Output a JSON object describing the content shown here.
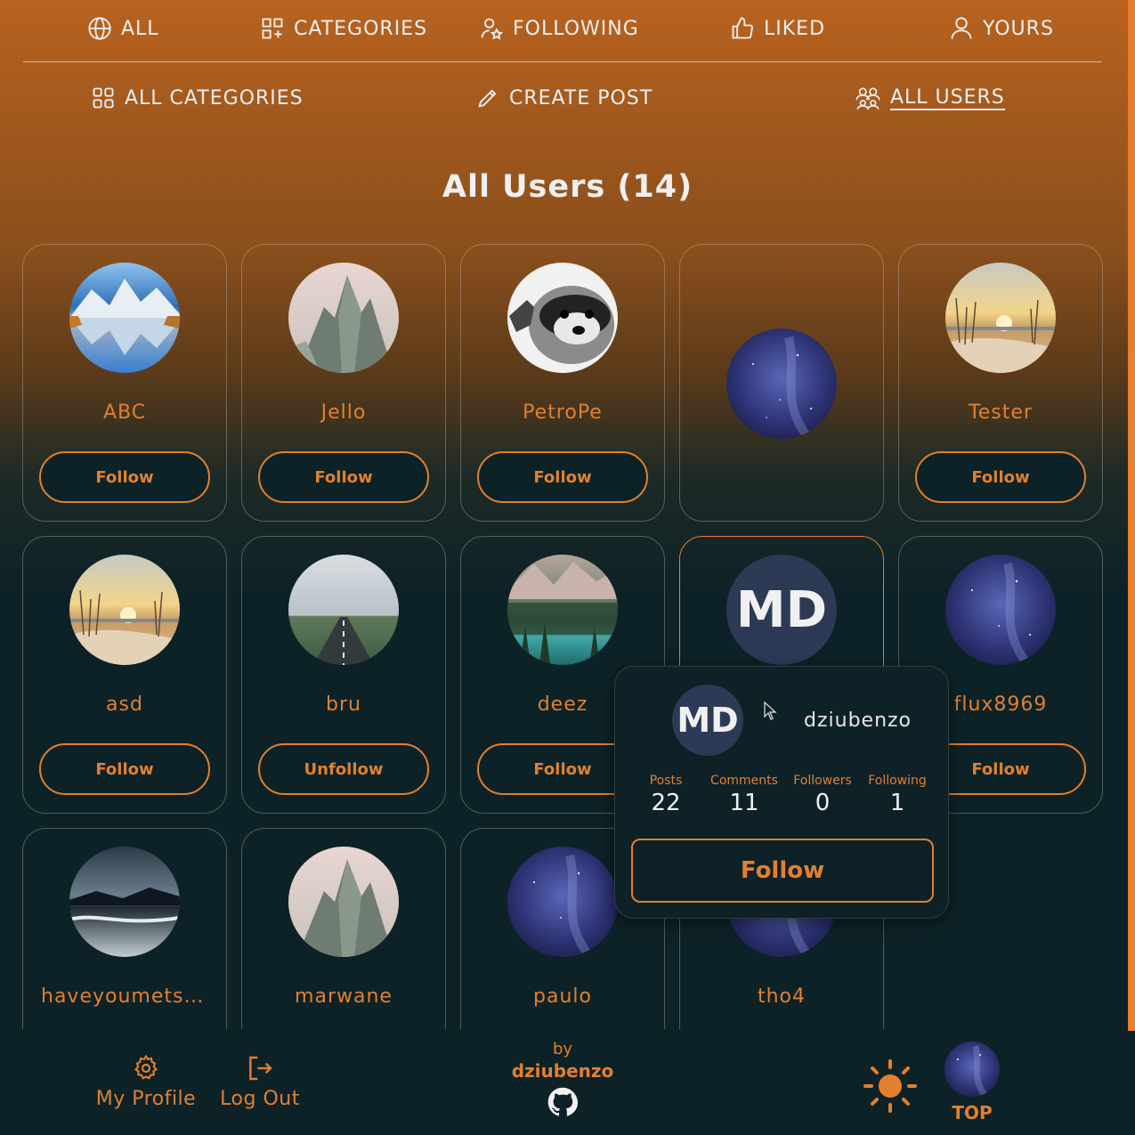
{
  "top_nav": [
    {
      "label": "ALL",
      "icon": "globe-icon"
    },
    {
      "label": "CATEGORIES",
      "icon": "grid-plus-icon"
    },
    {
      "label": "FOLLOWING",
      "icon": "user-star-icon"
    },
    {
      "label": "LIKED",
      "icon": "thumbs-up-icon"
    },
    {
      "label": "YOURS",
      "icon": "user-icon"
    }
  ],
  "sub_nav": [
    {
      "label": "ALL CATEGORIES",
      "icon": "grid-icon"
    },
    {
      "label": "CREATE POST",
      "icon": "pencil-icon"
    },
    {
      "label": "ALL USERS",
      "icon": "users-icon",
      "active": true
    }
  ],
  "page_title": "All Users (14)",
  "users": [
    {
      "name": "ABC",
      "button": "Follow",
      "avatar": "mountain-lake-reflection"
    },
    {
      "name": "Jello",
      "button": "Follow",
      "avatar": "rocky-peaks"
    },
    {
      "name": "PetroPe",
      "button": "Follow",
      "avatar": "raccoon"
    },
    {
      "name": "",
      "button": "",
      "avatar": "starry-sky"
    },
    {
      "name": "Tester",
      "button": "Follow",
      "avatar": "beach-sunset"
    },
    {
      "name": "asd",
      "button": "Follow",
      "avatar": "beach-sunset"
    },
    {
      "name": "bru",
      "button": "Unfollow",
      "avatar": "foggy-road"
    },
    {
      "name": "deez",
      "button": "Follow",
      "avatar": "alpine-lake"
    },
    {
      "name": "dziubenzo",
      "button": "",
      "avatar": "initials",
      "initials": "MD"
    },
    {
      "name": "flux8969",
      "button": "Follow",
      "avatar": "starry-sky"
    },
    {
      "name": "haveyoumetsa..",
      "button": "",
      "avatar": "stormy-coast"
    },
    {
      "name": "marwane",
      "button": "",
      "avatar": "rocky-peaks"
    },
    {
      "name": "paulo",
      "button": "",
      "avatar": "starry-sky"
    },
    {
      "name": "tho4",
      "button": "",
      "avatar": "starry-sky"
    }
  ],
  "popup": {
    "initials": "MD",
    "username": "dziubenzo",
    "stats": [
      {
        "label": "Posts",
        "value": "22"
      },
      {
        "label": "Comments",
        "value": "11"
      },
      {
        "label": "Followers",
        "value": "0"
      },
      {
        "label": "Following",
        "value": "1"
      }
    ],
    "button": "Follow"
  },
  "footer": {
    "my_profile": "My Profile",
    "log_out": "Log Out",
    "by": "by",
    "author": "dziubenzo",
    "top": "TOP"
  },
  "colors": {
    "accent": "#e2802e",
    "bg_dark": "#0d2227",
    "gradient_top": "#b8621f"
  }
}
